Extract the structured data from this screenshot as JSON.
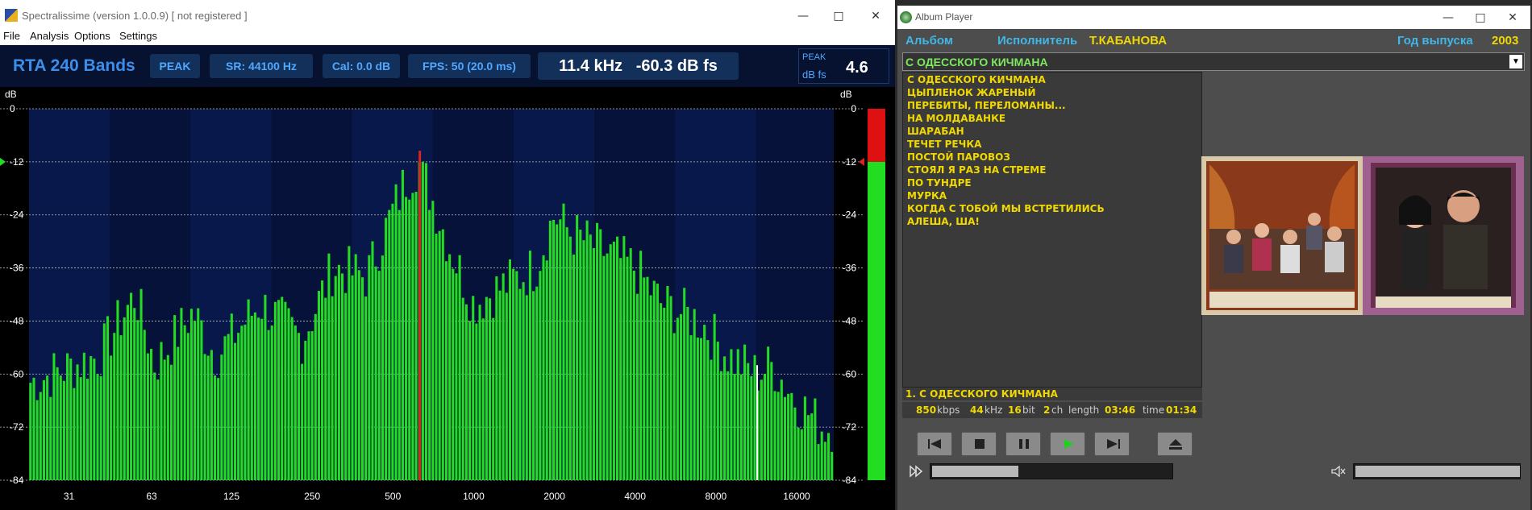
{
  "spectralissime": {
    "title": "Spectralissime (version 1.0.0.9) [ not registered ]",
    "menu": [
      "File",
      "Analysis",
      "Options",
      "Settings"
    ],
    "toolbar": {
      "rta": "RTA 240 Bands",
      "peak": "PEAK",
      "sr": "SR: 44100 Hz",
      "cal": "Cal:  0.0 dB",
      "fps": "FPS: 50   (20.0 ms)",
      "freq": "11.4 kHz",
      "level": "-60.3 dB fs",
      "peak_label": "PEAK",
      "dbfs_label": "dB fs",
      "peak_value": "4.6"
    },
    "colors": {
      "bar": "#22dd22",
      "marker": "#dd2222",
      "meter_red": "#dd1111",
      "meter_green": "#22dd22",
      "bg": "#06123a"
    }
  },
  "chart_data": {
    "type": "bar",
    "title": "",
    "ylabel": "dB",
    "ylim": [
      -84,
      0
    ],
    "y_ticks": [
      "0",
      "-12",
      "-24",
      "-36",
      "-48",
      "-60",
      "-72",
      "-84"
    ],
    "x_ticks": [
      "31",
      "63",
      "125",
      "250",
      "500",
      "1000",
      "2000",
      "4000",
      "8000",
      "16000"
    ],
    "bands": 240,
    "peak_marker_hz": 630,
    "cursor_hz": 11400,
    "peak_meter_db": -12,
    "grid": true
  },
  "album_player": {
    "title": "Album Player",
    "album_label": "Альбом",
    "artist_label": "Исполнитель",
    "artist": "Т.КАБАНОВА",
    "year_label": "Год выпуска",
    "year": "2003",
    "album": "С ОДЕССКОГО КИЧМАНА",
    "tracks": [
      "С ОДЕССКОГО КИЧМАНА",
      "ЦЫПЛЕНОК ЖАРЕНЫЙ",
      "ПЕРЕБИТЫ, ПЕРЕЛОМАНЫ...",
      "НА МОЛДАВАНКЕ",
      "ШАРАБАН",
      "ТЕЧЕТ РЕЧКА",
      "ПОСТОЙ ПАРОВОЗ",
      "СТОЯЛ Я РАЗ НА СТРЕМЕ",
      "ПО ТУНДРЕ",
      "МУРКА",
      "КОГДА С ТОБОЙ МЫ ВСТРЕТИЛИСЬ",
      "АЛЕША, ША!"
    ],
    "now_playing": "1.  С ОДЕССКОГО КИЧМАНА",
    "info": {
      "kbps": "850",
      "kbps_unit": "kbps",
      "khz": "44",
      "khz_unit": "kHz",
      "bit": "16",
      "bit_unit": "bit",
      "ch": "2",
      "ch_unit": "ch",
      "length_label": "length",
      "length": "03:46",
      "time_label": "time",
      "time": "01:34"
    },
    "seek_progress": 0.36,
    "volume_level": 0.0
  }
}
